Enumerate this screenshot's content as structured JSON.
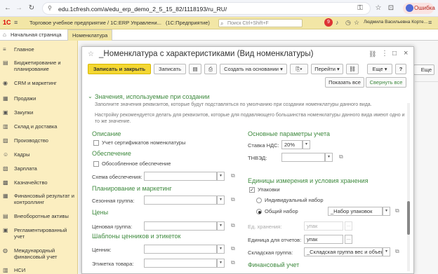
{
  "browser": {
    "url": "edu.1cfresh.com/a/edu_erp_demo_2_5_15_82/1118193/ru_RU/",
    "error_label": "Ошибка"
  },
  "app": {
    "logo": "1С",
    "title": "Торговое учебное предприятие / 1С:ERP Управлени...",
    "platform": "(1С:Предприятие)",
    "search_placeholder": "Поиск Ctrl+Shift+F",
    "notification_count": "9",
    "user": "Людмила Васильевна Корте..."
  },
  "tabs": {
    "home": "Начальная страница",
    "nomenclature": "Номенклатура"
  },
  "sidebar": {
    "items": [
      {
        "label": "Главное",
        "icon": "menu-icon"
      },
      {
        "label": "Бюджетирование и планирование",
        "icon": "chart-icon"
      },
      {
        "label": "CRM и маркетинг",
        "icon": "crm-icon"
      },
      {
        "label": "Продажи",
        "icon": "sales-icon"
      },
      {
        "label": "Закупки",
        "icon": "cart-icon"
      },
      {
        "label": "Склад и доставка",
        "icon": "warehouse-icon"
      },
      {
        "label": "Производство",
        "icon": "factory-icon"
      },
      {
        "label": "Кадры",
        "icon": "people-icon"
      },
      {
        "label": "Зарплата",
        "icon": "salary-icon"
      },
      {
        "label": "Казначейство",
        "icon": "treasury-icon"
      },
      {
        "label": "Финансовый результат и контроллинг",
        "icon": "finance-icon"
      },
      {
        "label": "Внеоборотные активы",
        "icon": "assets-icon"
      },
      {
        "label": "Регламентированный учет",
        "icon": "regulated-icon"
      },
      {
        "label": "Международный финансовый учет",
        "icon": "global-icon"
      },
      {
        "label": "НСИ",
        "icon": "nsi-icon"
      }
    ]
  },
  "modal": {
    "title": "_Номенклатура с характеристиками (Вид номенклатуры)",
    "toolbar": {
      "save_close": "Записать и закрыть",
      "save": "Записать",
      "create_based": "Создать на основании",
      "goto": "Перейти",
      "more": "Еще",
      "help": "?"
    },
    "bg_more": "Еще",
    "show_all": "Показать все",
    "collapse_all": "Свернуть все",
    "section_title": "Значения, используемые при создании",
    "info1": "Заполните значения реквизитов, которые будут подставляться по умолчанию при создании номенклатуры данного вида.",
    "info2": "Настройку рекомендуется делать для реквизитов, которые для подавляющего большинства номенклатуры данного вида имеют одно и то же значение.",
    "left": {
      "description_title": "Описание",
      "cert_checkbox": "Учет сертификатов номенклатуры",
      "supply_title": "Обеспечение",
      "separate_supply": "Обособленное обеспечение",
      "supply_scheme_label": "Схема обеспечения:",
      "planning_title": "Планирование и маркетинг",
      "season_group_label": "Сезонная группа:",
      "prices_title": "Цены",
      "price_group_label": "Ценовая группа:",
      "templates_title": "Шаблоны ценников и этикеток",
      "price_tag_label": "Ценник:",
      "product_label_label": "Этикетка товара:"
    },
    "right": {
      "params_title": "Основные параметры учета",
      "vat_label": "Ставка НДС:",
      "vat_value": "20%",
      "tnved_label": "ТНВЭД:",
      "units_title": "Единицы измерения и условия хранения",
      "packages_checkbox": "Упаковки",
      "individual_set": "Индивидуальный набор",
      "common_set": "Общий набор",
      "package_set_value": "_Набор упаковок",
      "storage_unit_label": "Ед. хранения:",
      "storage_unit_value": "упак",
      "report_unit_label": "Единица для отчетов:",
      "report_unit_value": "упак",
      "warehouse_group_label": "Складская группа:",
      "warehouse_group_value": "_Складская группа вес и объек",
      "finance_title": "Финансовый учет"
    }
  }
}
